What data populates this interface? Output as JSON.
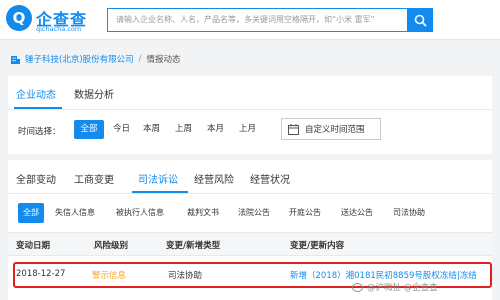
{
  "header": {
    "logo_mark": "Q",
    "logo_text": "企查查",
    "logo_sub": "qichacha.com",
    "search_placeholder": "请输入企业名称、人名，产品名等，多关键词用空格隔开，如“小米 雷军”",
    "search_icon": "search-icon",
    "brand_color": "#128bed"
  },
  "breadcrumb": {
    "company": "锤子科技(北京)股份有限公司",
    "separator": "/",
    "current": "情报动态"
  },
  "top_tabs": {
    "items": [
      "企业动态",
      "数据分析"
    ],
    "active": "企业动态"
  },
  "time_filter": {
    "label": "时间选择：",
    "options": [
      "全部",
      "今日",
      "本周",
      "上周",
      "本月",
      "上月"
    ],
    "active": "全部",
    "custom_label": "自定义时间范围",
    "custom_icon": "calendar-icon"
  },
  "category_tabs": {
    "items": [
      "全部变动",
      "工商变更",
      "司法诉讼",
      "经营风险",
      "经营状况"
    ],
    "active": "司法诉讼"
  },
  "sub_filters": {
    "items": [
      "全部",
      "失信人信息",
      "被执行人信息",
      "裁判文书",
      "法院公告",
      "开庭公告",
      "送达公告",
      "司法协助"
    ],
    "active": "全部"
  },
  "table": {
    "columns": [
      "变动日期",
      "风险级别",
      "变更/新增类型",
      "变更/更新内容"
    ],
    "rows": [
      {
        "date": "2018-12-27",
        "risk": "警示信息",
        "type": "司法协助",
        "content": "新增（2018）湘0181民初8859号股权冻结|冻结"
      }
    ]
  },
  "watermark": {
    "text": "@沪嗨扯 @企查查"
  }
}
